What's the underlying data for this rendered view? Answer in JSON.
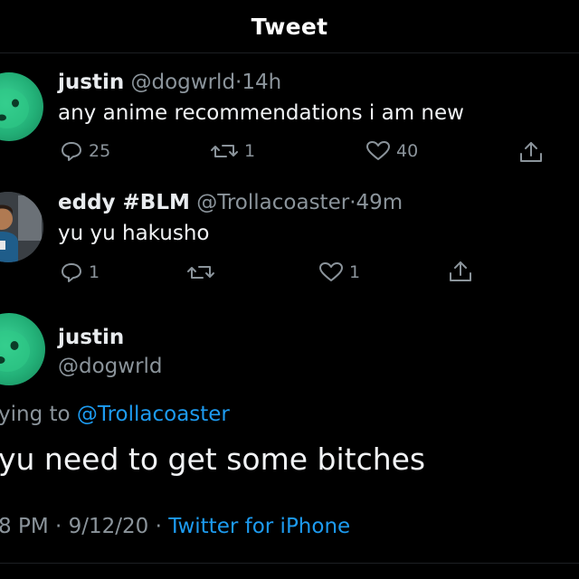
{
  "header": {
    "title": "Tweet"
  },
  "tweet1": {
    "name": "justin",
    "handle": "@dogwrld",
    "sep": "·",
    "time": "14h",
    "text": "any anime recommendations i am new",
    "replies": "25",
    "retweets": "1",
    "likes": "40",
    "avatar_icon": "dog-avatar"
  },
  "tweet2": {
    "name": "eddy #BLM",
    "handle": "@Trollacoaster",
    "sep": "·",
    "time": "49m",
    "text": "yu yu hakusho",
    "replies": "1",
    "likes": "1",
    "avatar_icon": "person-avatar"
  },
  "main": {
    "name": "justin",
    "handle": "@dogwrld",
    "replying_prefix": "ying to",
    "replying_to": "@Trollacoaster",
    "text": "yu need to get some bitches",
    "time_text": "8 PM",
    "sep": "·",
    "date": "9/12/20",
    "source": "Twitter for iPhone"
  },
  "colors": {
    "background": "#000000",
    "muted": "#8b949b",
    "link": "#1d9bf0",
    "avatar": "#23b178"
  }
}
